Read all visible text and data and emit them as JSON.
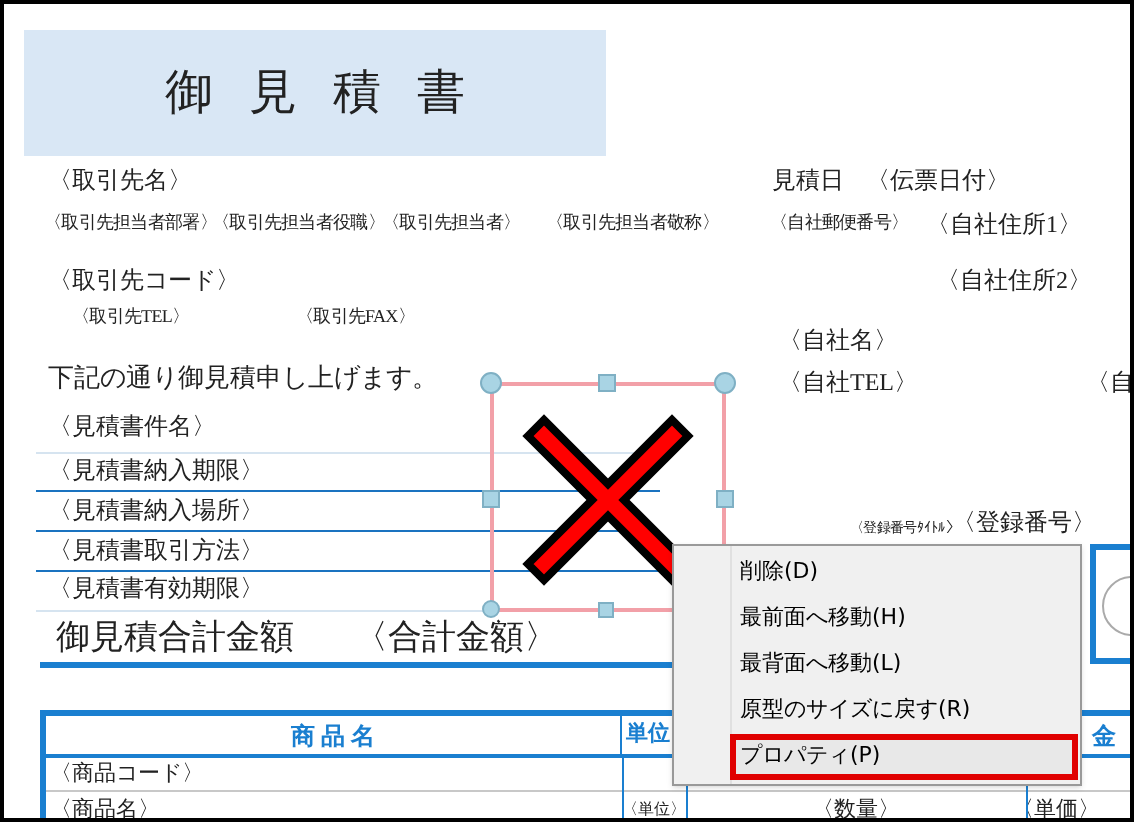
{
  "title": "御見積書",
  "fields": [
    {
      "text": "〈取引先名〉"
    },
    {
      "text": "〈取引先担当者部署〉"
    },
    {
      "text": "〈取引先担当者役職〉"
    },
    {
      "text": "〈取引先担当者〉"
    },
    {
      "text": "〈取引先担当者敬称〉"
    },
    {
      "text": "見積日"
    },
    {
      "text": "〈伝票日付〉"
    },
    {
      "text": "〈自社郵便番号〉"
    },
    {
      "text": "〈自社住所1〉"
    },
    {
      "text": "〈取引先コード〉"
    },
    {
      "text": "〈自社住所2〉"
    },
    {
      "text": "〈取引先TEL〉"
    },
    {
      "text": "〈取引先FAX〉"
    },
    {
      "text": "下記の通り御見積申し上げます。"
    },
    {
      "text": "〈自社名〉"
    },
    {
      "text": "〈自社TEL〉"
    },
    {
      "text": "〈自"
    },
    {
      "text": "〈見積書件名〉"
    },
    {
      "text": "〈見積書納入期限〉"
    },
    {
      "text": "〈見積書納入場所〉"
    },
    {
      "text": "〈見積書取引方法〉"
    },
    {
      "text": "〈見積書有効期限〉"
    },
    {
      "text": "〈登録番号ﾀｲﾄﾙ〉"
    },
    {
      "text": "〈登録番号〉"
    },
    {
      "text": "御見積合計金額"
    },
    {
      "text": "〈合計金額〉"
    }
  ],
  "table": {
    "headers": [
      "商 品 名",
      "単位",
      "金"
    ],
    "rows": [
      [
        "〈商品コード〉"
      ],
      [
        "〈商品名〉",
        "〈単位〉",
        "〈数量〉",
        "〈単価〉"
      ]
    ]
  },
  "context_menu": [
    {
      "label": "削除(D)",
      "selected": false
    },
    {
      "label": "最前面へ移動(H)",
      "selected": false
    },
    {
      "label": "最背面へ移動(L)",
      "selected": false
    },
    {
      "label": "原型のサイズに戻す(R)",
      "selected": false
    },
    {
      "label": "プロパティ(P)",
      "selected": true
    }
  ]
}
